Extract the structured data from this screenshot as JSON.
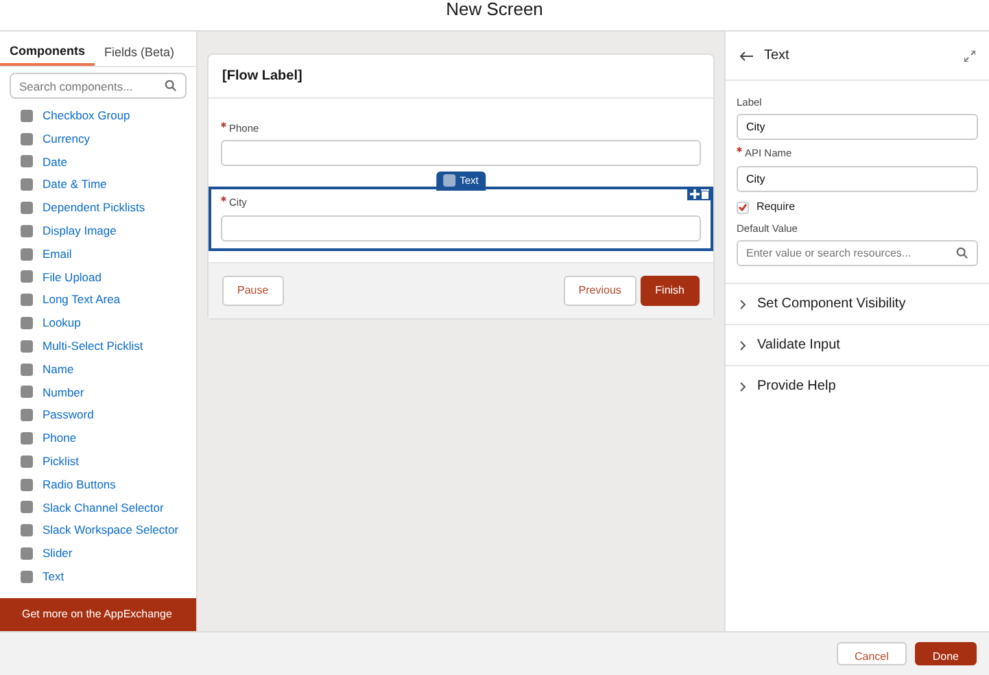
{
  "window": {
    "title": "New Screen"
  },
  "palette": {
    "tabs": [
      {
        "label": "Components",
        "selected": true
      },
      {
        "label": "Fields (Beta)",
        "selected": false
      }
    ],
    "search": {
      "placeholder": "Search components..."
    },
    "items": [
      "Checkbox Group",
      "Currency",
      "Date",
      "Date & Time",
      "Dependent Picklists",
      "Display Image",
      "Email",
      "File Upload",
      "Long Text Area",
      "Lookup",
      "Multi-Select Picklist",
      "Name",
      "Number",
      "Password",
      "Phone",
      "Picklist",
      "Radio Buttons",
      "Slack Channel Selector",
      "Slack Workspace Selector",
      "Slider",
      "Text"
    ],
    "footer_link": "Get more on the AppExchange"
  },
  "canvas": {
    "title": "[Flow Label]",
    "fields": [
      {
        "label": "Phone",
        "required": true,
        "selected": false
      },
      {
        "label": "City",
        "required": true,
        "selected": true,
        "tag": "Text"
      }
    ],
    "buttons_left": [
      "Pause"
    ],
    "buttons_right": [
      {
        "label": "Previous",
        "kind": "neutral"
      },
      {
        "label": "Finish",
        "kind": "brand"
      }
    ]
  },
  "properties": {
    "title": "Text",
    "label": {
      "label": "Label",
      "value": "City",
      "required": false
    },
    "api_name": {
      "label": "API Name",
      "value": "City",
      "required": true
    },
    "require": {
      "label": "Require",
      "checked": true
    },
    "default_value": {
      "label": "Default Value",
      "placeholder": "Enter value or search resources..."
    },
    "sections": [
      {
        "label": "Set Component Visibility",
        "expanded": false
      },
      {
        "label": "Validate Input",
        "expanded": false
      },
      {
        "label": "Provide Help",
        "expanded": false
      }
    ]
  },
  "footer": {
    "buttons": [
      {
        "label": "Cancel",
        "kind": "neutral"
      },
      {
        "label": "Done",
        "kind": "brand"
      }
    ]
  }
}
